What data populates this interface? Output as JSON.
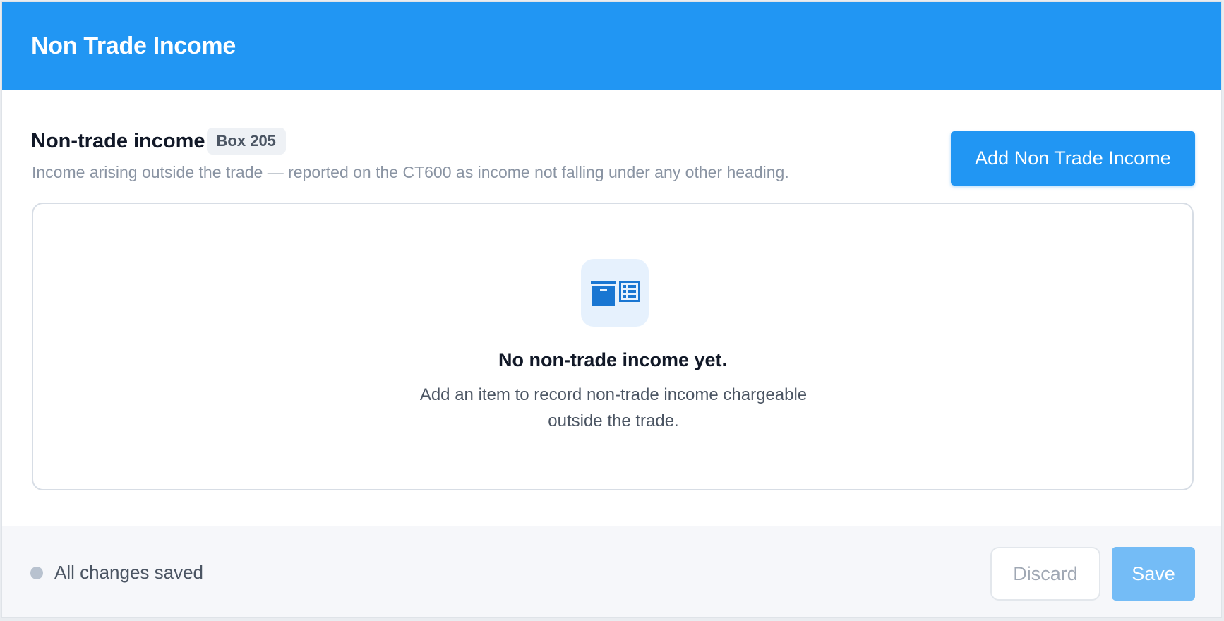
{
  "header": {
    "title": "Non Trade Income"
  },
  "section": {
    "title": "Non-trade income",
    "badge": "Box 205",
    "description": "Income arising outside the trade — reported on the CT600 as income not falling under any other heading.",
    "add_button_label": "Add Non Trade Income"
  },
  "empty_state": {
    "icon": "archive-ledger-icon",
    "title": "No non-trade income yet.",
    "text": "Add an item to record non-trade income chargeable outside the trade."
  },
  "footer": {
    "status_text": "All changes saved",
    "discard_label": "Discard",
    "save_label": "Save"
  },
  "colors": {
    "header_bg": "#2196f3",
    "primary": "#2196f3",
    "save_disabled": "#74bcf6",
    "icon_blue": "#1976d2"
  }
}
